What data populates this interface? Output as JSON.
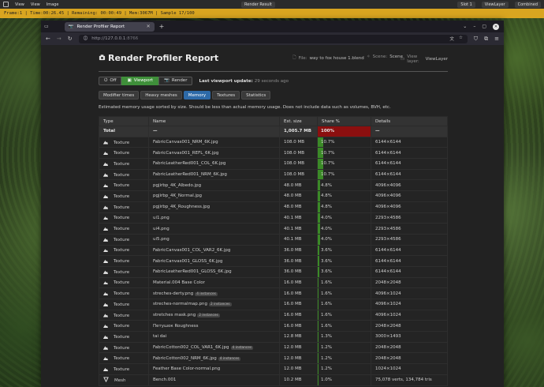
{
  "blender": {
    "menus": [
      "View",
      "View",
      "Image"
    ],
    "render_result": "Render Result",
    "slot": "Slot 1",
    "view_layer": "ViewLayer",
    "display": "Combined",
    "status": "Frame:1 | Time:00:26.45 | Remaining: 00:00:49 | Mem:3067M | Sample 17/100"
  },
  "browser": {
    "tab_title": "Render Profiler Report",
    "url_host": "http://127.0.0.1",
    "url_port": ":8766"
  },
  "report": {
    "title": "Render Profiler Report",
    "file_label": "File:",
    "file_value": "way to fox house 1.blend",
    "scene_label": "Scene:",
    "scene_value": "Scene",
    "viewlayer_label": "View layer:",
    "viewlayer_value": "ViewLayer",
    "modes": {
      "off": "Off",
      "viewport": "Viewport",
      "render": "Render"
    },
    "last_update_label": "Last viewport update:",
    "last_update_value": "29 seconds ago",
    "tabs": [
      "Modifier times",
      "Heavy meshes",
      "Memory",
      "Textures",
      "Statistics"
    ],
    "active_tab": "Memory",
    "description": "Estimated memory usage sorted by size. Should be less than actual memory usage. Does not include data such as volumes, BVH, etc.",
    "columns": {
      "type": "Type",
      "name": "Name",
      "size": "Est. size",
      "share": "Share %",
      "details": "Details"
    },
    "total": {
      "label": "Total",
      "name": "—",
      "size": "1,005.7 MB",
      "share": "100%",
      "details": "—"
    },
    "rows": [
      {
        "type": "Texture",
        "name": "FabricCanvas001_NRM_6K.jpg",
        "badge": "",
        "size": "108.0 MB",
        "share": "10.7%",
        "share_frac": 0.107,
        "details": "6144×6144"
      },
      {
        "type": "Texture",
        "name": "FabricCanvas001_REFL_6K.jpg",
        "badge": "",
        "size": "108.0 MB",
        "share": "10.7%",
        "share_frac": 0.107,
        "details": "6144×6144"
      },
      {
        "type": "Texture",
        "name": "FabricLeatherRed001_COL_6K.jpg",
        "badge": "",
        "size": "108.0 MB",
        "share": "10.7%",
        "share_frac": 0.107,
        "details": "6144×6144"
      },
      {
        "type": "Texture",
        "name": "FabricLeatherRed001_NRM_6K.jpg",
        "badge": "",
        "size": "108.0 MB",
        "share": "10.7%",
        "share_frac": 0.107,
        "details": "6144×6144"
      },
      {
        "type": "Texture",
        "name": "pgjirbp_4K_Albedo.jpg",
        "badge": "",
        "size": "48.0 MB",
        "share": "4.8%",
        "share_frac": 0.048,
        "details": "4096×4096"
      },
      {
        "type": "Texture",
        "name": "pgjirbp_4K_Normal.jpg",
        "badge": "",
        "size": "48.0 MB",
        "share": "4.8%",
        "share_frac": 0.048,
        "details": "4096×4096"
      },
      {
        "type": "Texture",
        "name": "pgjirbp_4K_Roughness.jpg",
        "badge": "",
        "size": "48.0 MB",
        "share": "4.8%",
        "share_frac": 0.048,
        "details": "4096×4096"
      },
      {
        "type": "Texture",
        "name": "ui1.png",
        "badge": "",
        "size": "40.1 MB",
        "share": "4.0%",
        "share_frac": 0.04,
        "details": "2293×4586"
      },
      {
        "type": "Texture",
        "name": "ui4.png",
        "badge": "",
        "size": "40.1 MB",
        "share": "4.0%",
        "share_frac": 0.04,
        "details": "2293×4586"
      },
      {
        "type": "Texture",
        "name": "ui5.png",
        "badge": "",
        "size": "40.1 MB",
        "share": "4.0%",
        "share_frac": 0.04,
        "details": "2293×4586"
      },
      {
        "type": "Texture",
        "name": "FabricCanvas001_COL_VAR2_6K.jpg",
        "badge": "",
        "size": "36.0 MB",
        "share": "3.6%",
        "share_frac": 0.036,
        "details": "6144×6144"
      },
      {
        "type": "Texture",
        "name": "FabricCanvas001_GLOSS_6K.jpg",
        "badge": "",
        "size": "36.0 MB",
        "share": "3.6%",
        "share_frac": 0.036,
        "details": "6144×6144"
      },
      {
        "type": "Texture",
        "name": "FabricLeatherRed001_GLOSS_6K.jpg",
        "badge": "",
        "size": "36.0 MB",
        "share": "3.6%",
        "share_frac": 0.036,
        "details": "6144×6144"
      },
      {
        "type": "Texture",
        "name": "Material.004 Base Color",
        "badge": "",
        "size": "16.0 MB",
        "share": "1.6%",
        "share_frac": 0.016,
        "details": "2048×2048"
      },
      {
        "type": "Texture",
        "name": "streches-derty.png",
        "badge": "4 instances",
        "size": "16.0 MB",
        "share": "1.6%",
        "share_frac": 0.016,
        "details": "4096×1024"
      },
      {
        "type": "Texture",
        "name": "streches-normalmap.png",
        "badge": "2 instances",
        "size": "16.0 MB",
        "share": "1.6%",
        "share_frac": 0.016,
        "details": "4096×1024"
      },
      {
        "type": "Texture",
        "name": "stretches mask.png",
        "badge": "2 instances",
        "size": "16.0 MB",
        "share": "1.6%",
        "share_frac": 0.016,
        "details": "4096×1024"
      },
      {
        "type": "Texture",
        "name": "Петушок Roughness",
        "badge": "",
        "size": "16.0 MB",
        "share": "1.6%",
        "share_frac": 0.016,
        "details": "2048×2048"
      },
      {
        "type": "Texture",
        "name": "tai dai",
        "badge": "",
        "size": "12.8 MB",
        "share": "1.3%",
        "share_frac": 0.013,
        "details": "3000×1493"
      },
      {
        "type": "Texture",
        "name": "FabricCotton002_COL_VAR1_6K.jpg",
        "badge": "4 instances",
        "size": "12.0 MB",
        "share": "1.2%",
        "share_frac": 0.012,
        "details": "2048×2048"
      },
      {
        "type": "Texture",
        "name": "FabricCotton002_NRM_6K.jpg",
        "badge": "4 instances",
        "size": "12.0 MB",
        "share": "1.2%",
        "share_frac": 0.012,
        "details": "2048×2048"
      },
      {
        "type": "Texture",
        "name": "Feather Base Color-normal.png",
        "badge": "",
        "size": "12.0 MB",
        "share": "1.2%",
        "share_frac": 0.012,
        "details": "1024×1024"
      },
      {
        "type": "Mesh",
        "name": "Bench.001",
        "badge": "",
        "size": "10.2 MB",
        "share": "1.0%",
        "share_frac": 0.01,
        "details": "75,078 verts, 134,784 tris"
      }
    ]
  },
  "colors": {
    "accent_green": "#3f8f3a",
    "share_bar": "#3b8a27",
    "total_bar": "#8b0f0f",
    "active_tab": "#2d6aa8",
    "status_bar": "#d9a520"
  }
}
